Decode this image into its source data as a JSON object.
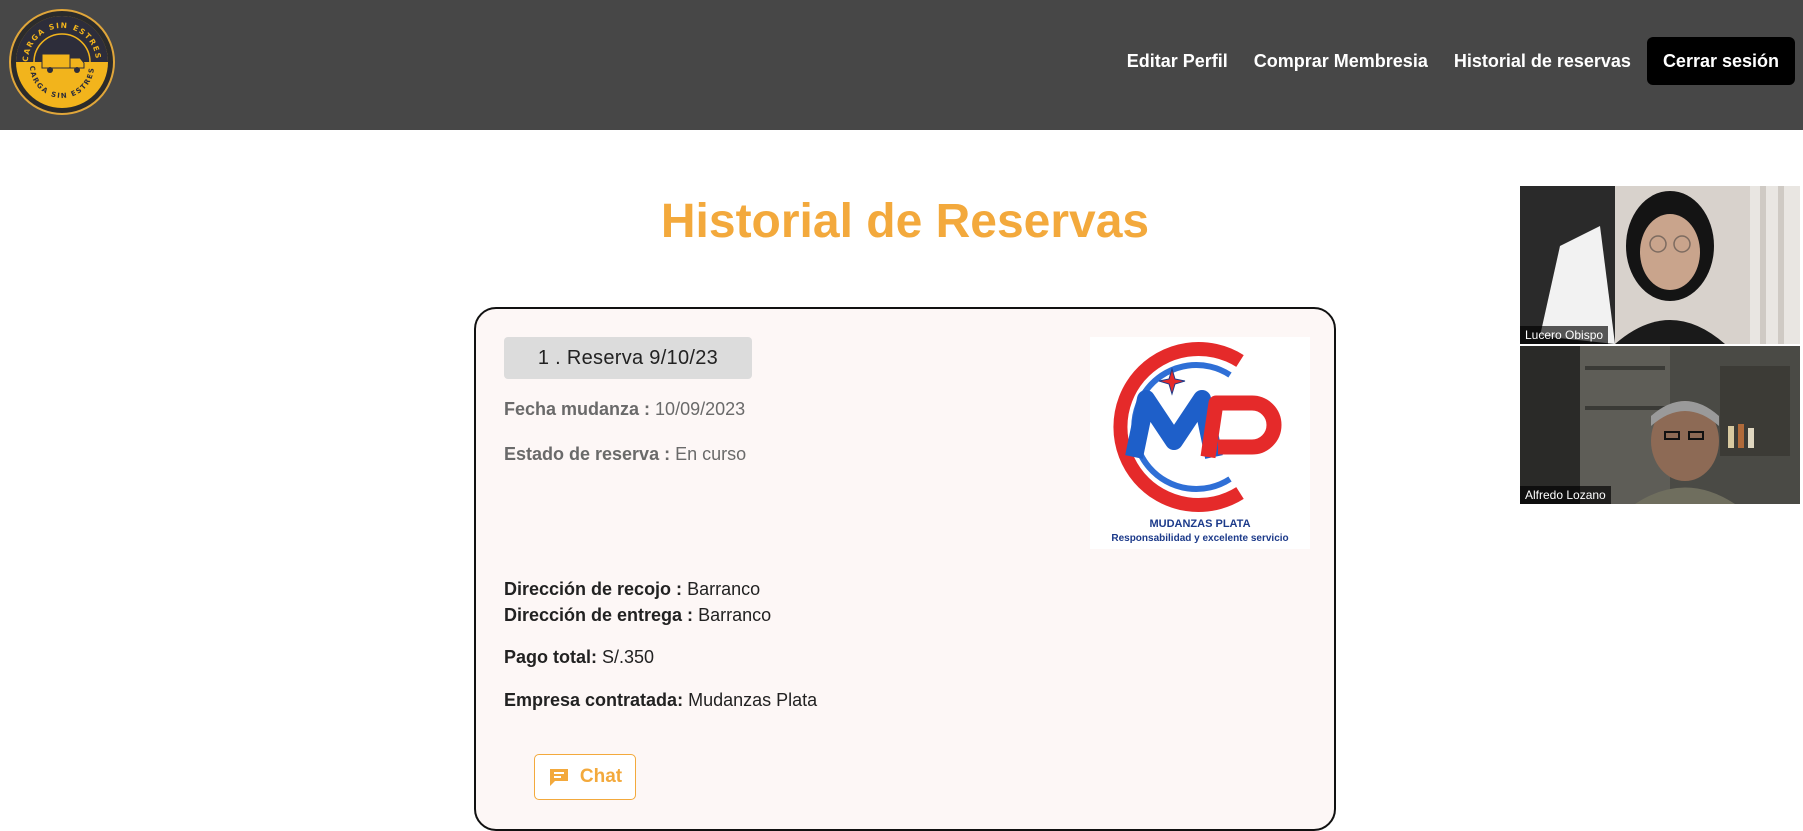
{
  "brand": {
    "logo_ring_text": "CARGA SIN ESTRES",
    "logo_lower_text": "CARGA SIN ESTRES",
    "colors": {
      "topbar": "#474747",
      "accent": "#f3a93c",
      "logout_bg": "#000000"
    }
  },
  "nav": {
    "items": [
      {
        "label": "Editar Perfil"
      },
      {
        "label": "Comprar Membresia"
      },
      {
        "label": "Historial de reservas"
      }
    ],
    "logout_label": "Cerrar sesión"
  },
  "page": {
    "title": "Historial de Reservas"
  },
  "reservation": {
    "title": "1 . Reserva 9/10/23",
    "fecha_label": "Fecha mudanza :",
    "fecha_value": "10/09/2023",
    "estado_label": "Estado de reserva :",
    "estado_value": "En curso",
    "recojo_label": "Dirección de recojo :",
    "recojo_value": "Barranco",
    "entrega_label": "Dirección de entrega :",
    "entrega_value": "Barranco",
    "pago_label": "Pago total:",
    "pago_value": "S/.350",
    "empresa_label": "Empresa contratada:",
    "empresa_value": "Mudanzas Plata",
    "company_logo": {
      "monogram": "MP",
      "name": "MUDANZAS PLATA",
      "slogan": "Responsabilidad y excelente servicio"
    },
    "chat_label": "Chat",
    "chat_icon": "chat-bubble-icon"
  },
  "video_call": {
    "participants": [
      {
        "name": "Lucero Obispo"
      },
      {
        "name": "Alfredo Lozano"
      }
    ]
  }
}
